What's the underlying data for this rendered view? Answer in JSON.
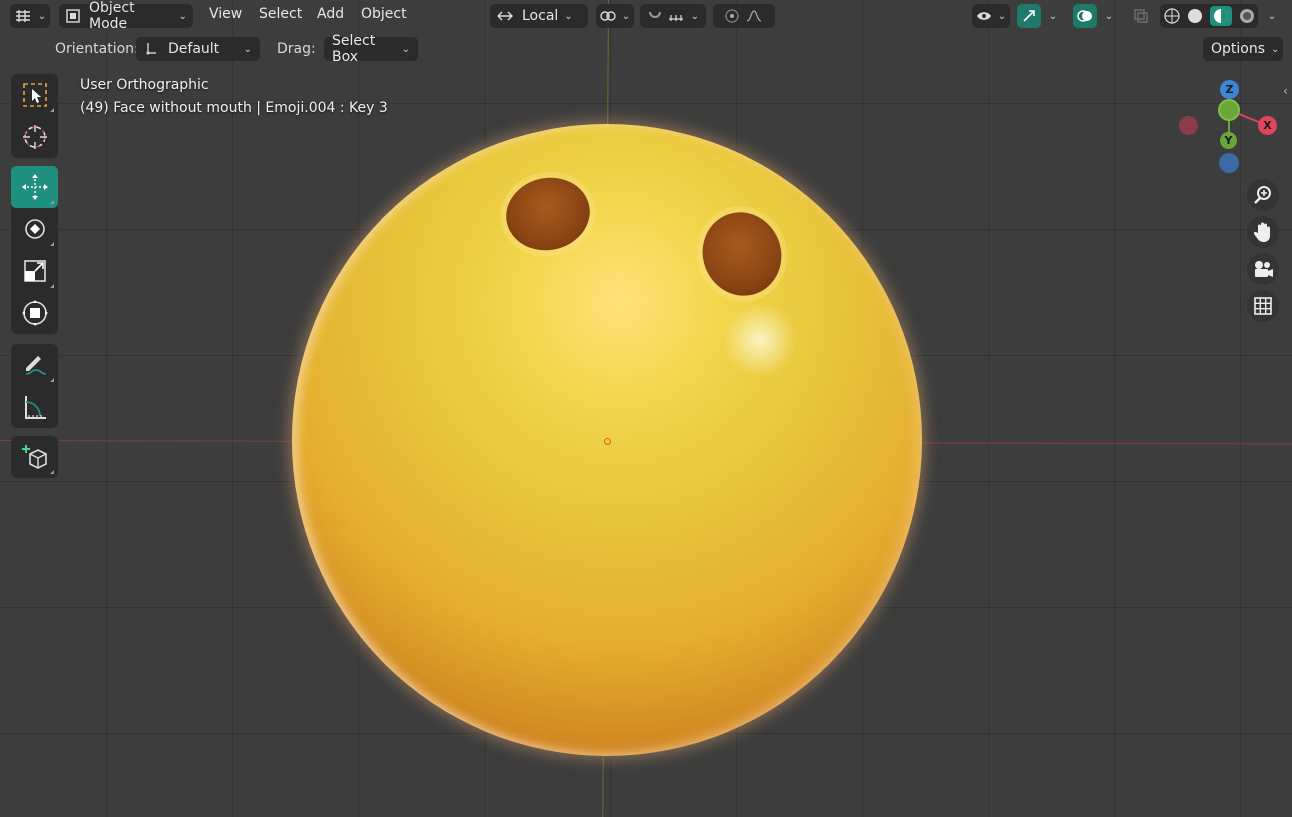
{
  "header": {
    "mode_label": "Object Mode",
    "menus": [
      "View",
      "Select",
      "Add",
      "Object"
    ],
    "transform_pivot_label": "Local",
    "colors": {
      "accent": "#1f8f7e",
      "panel": "#2b2b2b"
    }
  },
  "tool_header": {
    "orientation_label": "Orientation:",
    "orientation_value": "Default",
    "drag_label": "Drag:",
    "drag_value": "Select Box",
    "options_label": "Options"
  },
  "viewport": {
    "view_name": "User Orthographic",
    "object_info": "(49) Face without mouth | Emoji.004 : Key 3"
  },
  "gizmo": {
    "z": "Z",
    "y": "Y",
    "x": "X",
    "colors": {
      "x": "#e0455a",
      "y": "#6aa63a",
      "z": "#3d86d6"
    }
  },
  "toolbar": {
    "tools": [
      "select-box",
      "cursor",
      "move",
      "rotate",
      "scale",
      "transform",
      "annotate",
      "measure",
      "add-cube"
    ],
    "active_tool": "move"
  },
  "nav_buttons": [
    "zoom-icon",
    "hand-pan-icon",
    "camera-icon",
    "grid-icon"
  ]
}
